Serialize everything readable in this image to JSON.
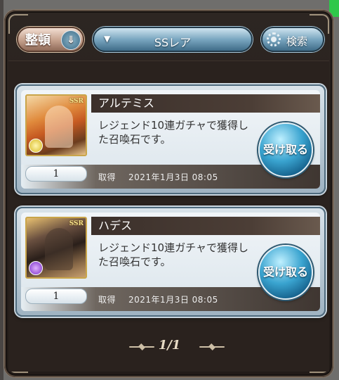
{
  "toolbar": {
    "sort_label": "整頓",
    "sort_icon": "chevrons-down-icon",
    "filter_label": "SSレア",
    "filter_arrow": "▼",
    "search_label": "検索",
    "search_icon": "gear-icon"
  },
  "items": [
    {
      "name": "アルテミス",
      "description": "レジェンド10連ガチャで獲得した召喚石です。",
      "count": "1",
      "acquired_label": "取得",
      "acquired_date": "2021年1月3日 08:05",
      "receive_label": "受け取る",
      "rarity": "SSR",
      "element": "light"
    },
    {
      "name": "ハデス",
      "description": "レジェンド10連ガチャで獲得した召喚石です。",
      "count": "1",
      "acquired_label": "取得",
      "acquired_date": "2021年1月3日 08:05",
      "receive_label": "受け取る",
      "rarity": "SSR",
      "element": "dark"
    }
  ],
  "pagination": {
    "label": "1/1"
  },
  "colors": {
    "panel": "#2d2622",
    "accent_blue": "#3aa4d0",
    "sort_button": "#c4a08c"
  }
}
